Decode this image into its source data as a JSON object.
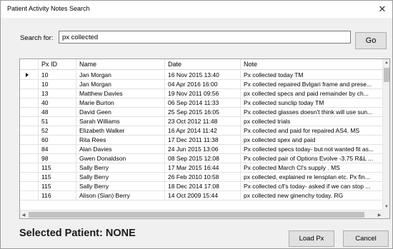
{
  "window": {
    "title": "Patient Activity Notes Search",
    "close_glyph": "✕"
  },
  "search": {
    "label": "Search for:",
    "value": "px collected",
    "go_label": "Go"
  },
  "grid": {
    "columns": [
      "Px ID",
      "Name",
      "Date",
      "Note"
    ],
    "rows": [
      {
        "id": "10",
        "name": "Jan Morgan",
        "date": "16 Nov 2015 13:40",
        "note": "Px collected today TM"
      },
      {
        "id": "10",
        "name": "Jan Morgan",
        "date": "04 Apr 2016 16:00",
        "note": "Px collected repaired Bvlgari frame and prese..."
      },
      {
        "id": "13",
        "name": "Matthew Davies",
        "date": "19 Nov 2011 09:56",
        "note": "px collected specs and paid remainder by ch..."
      },
      {
        "id": "40",
        "name": "Marie Burton",
        "date": "06 Sep 2014 11:33",
        "note": "Px collected sunclip today TM"
      },
      {
        "id": "48",
        "name": "David Geen",
        "date": "25 Sep 2015 16:05",
        "note": "Px collected glasses doesn't think will use sun..."
      },
      {
        "id": "51",
        "name": "Sarah Williams",
        "date": "23 Oct 2012 11:48",
        "note": "px collected trials"
      },
      {
        "id": "52",
        "name": "Elizabeth Walker",
        "date": "16 Apr 2014 11:42",
        "note": "Px collected and paid for repaired AS4. MS"
      },
      {
        "id": "60",
        "name": "Rita Rees",
        "date": "17 Dec 2011 11:38",
        "note": "px collected spex and paid"
      },
      {
        "id": "84",
        "name": "Alan Davies",
        "date": "24 Jun 2015 13:06",
        "note": "Px collected specs today- but not wanted fit as..."
      },
      {
        "id": "98",
        "name": "Gwen Donaldson",
        "date": "08 Sep 2015 12:08",
        "note": "Px collected pair of Options Evolve -3.75 R&L ..."
      },
      {
        "id": "115",
        "name": "Sally Berry",
        "date": "17 Mar 2015 16:44",
        "note": "Px collected March Cl's supply . MS"
      },
      {
        "id": "115",
        "name": "Sally Berry",
        "date": "26 Feb 2010 10:58",
        "note": " px collected, explained re lensplan etc. Px fin..."
      },
      {
        "id": "115",
        "name": "Sally Berry",
        "date": "18 Dec 2014 17:08",
        "note": "Px collected c/l's today- asked if we can stop ..."
      },
      {
        "id": "116",
        "name": "Alison  (Sian) Berry",
        "date": "14 Oct 2009 15:44",
        "note": " px collected new ginenchy today. RG"
      }
    ]
  },
  "status": {
    "selected_patient": "Selected Patient: NONE"
  },
  "buttons": {
    "load": "Load Px",
    "cancel": "Cancel"
  }
}
